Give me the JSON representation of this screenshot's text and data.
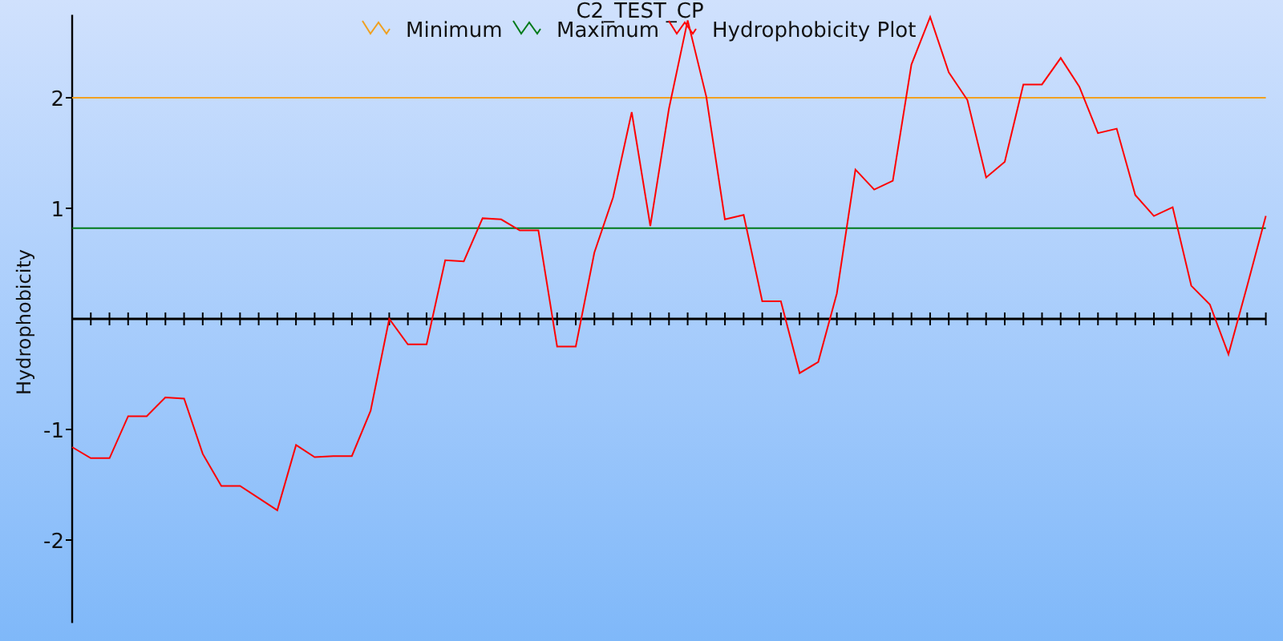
{
  "chart_data": {
    "type": "line",
    "title": "C2_TEST_CP",
    "legend": "top",
    "ylabel": "Hydrophobicity",
    "ylim": [
      -2.75,
      2.75
    ],
    "yticks": [
      -2,
      -1,
      1,
      2
    ],
    "series": [
      {
        "name": "Minimum",
        "color": "#f0a020",
        "values": [
          2,
          2,
          2,
          2,
          2,
          2,
          2,
          2,
          2,
          2,
          2,
          2,
          2,
          2,
          2,
          2,
          2,
          2,
          2,
          2,
          2,
          2,
          2,
          2,
          2,
          2,
          2,
          2,
          2,
          2,
          2,
          2,
          2,
          2,
          2,
          2,
          2,
          2,
          2,
          2,
          2,
          2,
          2,
          2,
          2,
          2,
          2,
          2,
          2,
          2,
          2,
          2,
          2,
          2,
          2,
          2,
          2,
          2,
          2,
          2,
          2,
          2,
          2,
          2,
          2
        ]
      },
      {
        "name": "Maximum",
        "color": "#007a1a",
        "values": [
          0.82,
          0.82,
          0.82,
          0.82,
          0.82,
          0.82,
          0.82,
          0.82,
          0.82,
          0.82,
          0.82,
          0.82,
          0.82,
          0.82,
          0.82,
          0.82,
          0.82,
          0.82,
          0.82,
          0.82,
          0.82,
          0.82,
          0.82,
          0.82,
          0.82,
          0.82,
          0.82,
          0.82,
          0.82,
          0.82,
          0.82,
          0.82,
          0.82,
          0.82,
          0.82,
          0.82,
          0.82,
          0.82,
          0.82,
          0.82,
          0.82,
          0.82,
          0.82,
          0.82,
          0.82,
          0.82,
          0.82,
          0.82,
          0.82,
          0.82,
          0.82,
          0.82,
          0.82,
          0.82,
          0.82,
          0.82,
          0.82,
          0.82,
          0.82,
          0.82,
          0.82,
          0.82,
          0.82,
          0.82,
          0.82
        ]
      },
      {
        "name": "Hydrophobicity Plot",
        "color": "#ff0000",
        "values": [
          -1.16,
          -1.26,
          -1.26,
          -0.88,
          -0.88,
          -0.71,
          -0.72,
          -1.22,
          -1.51,
          -1.51,
          -1.62,
          -1.73,
          -1.14,
          -1.25,
          -1.24,
          -1.24,
          -0.83,
          0,
          -0.23,
          -0.23,
          0.53,
          0.52,
          0.91,
          0.9,
          0.8,
          0.8,
          -0.25,
          -0.25,
          0.6,
          1.1,
          1.87,
          0.84,
          1.9,
          2.7,
          2.01,
          0.9,
          0.94,
          0.16,
          0.16,
          -0.49,
          -0.39,
          0.23,
          1.35,
          1.17,
          1.25,
          2.3,
          2.73,
          2.23,
          1.98,
          1.28,
          1.42,
          2.12,
          2.12,
          2.36,
          2.1,
          1.68,
          1.72,
          1.12,
          0.93,
          1.01,
          0.3,
          0.13,
          -0.32,
          0.3,
          0.93
        ]
      }
    ]
  }
}
